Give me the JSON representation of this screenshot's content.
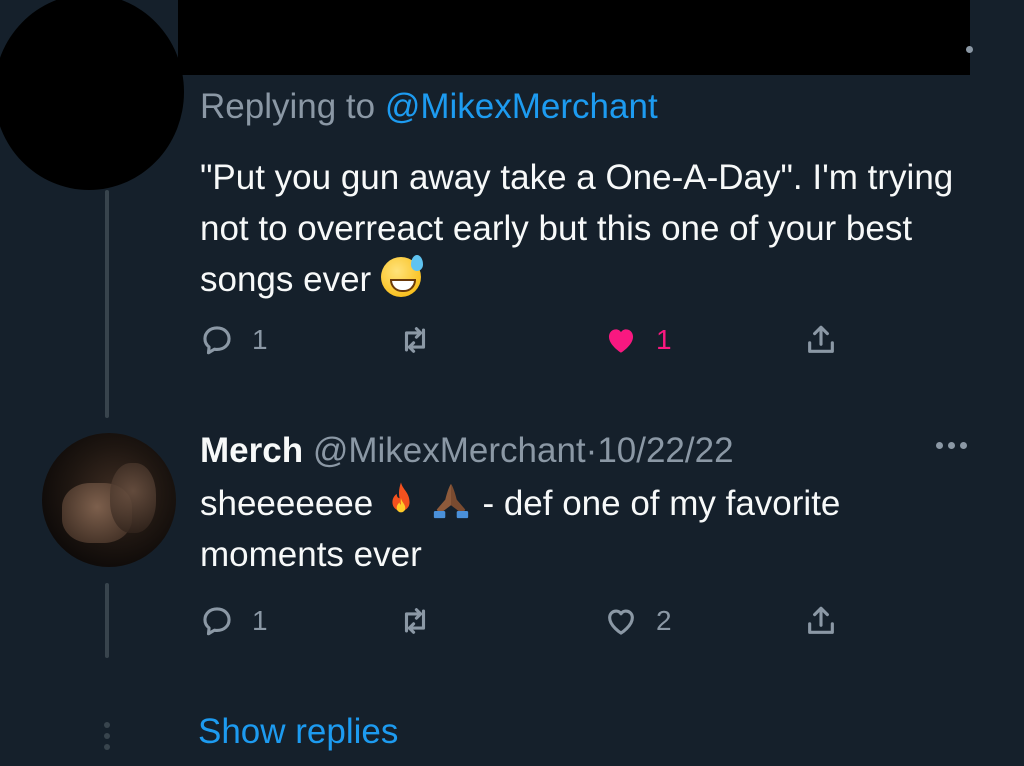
{
  "tweet": {
    "replying_prefix": "Replying to",
    "replying_handle": "@MikexMerchant",
    "text": "\"Put you gun away take a One-A-Day\". I'm trying not to overreact early but this one of your best songs ever",
    "emoji": "sweat-smile",
    "stats": {
      "replies": "1",
      "likes": "1"
    }
  },
  "reply": {
    "name": "Merch",
    "handle": "@MikexMerchant",
    "separator": "·",
    "date": "10/22/22",
    "text_start": "sheeeeeee",
    "emojis": [
      "fire",
      "folded-hands"
    ],
    "text_end": "- def one of my favorite moments ever",
    "stats": {
      "replies": "1",
      "likes": "2"
    }
  },
  "thread": {
    "show_replies": "Show replies"
  },
  "colors": {
    "background": "#15202b",
    "accent": "#1d9bf0",
    "like": "#f91880",
    "muted": "#8b98a5"
  }
}
